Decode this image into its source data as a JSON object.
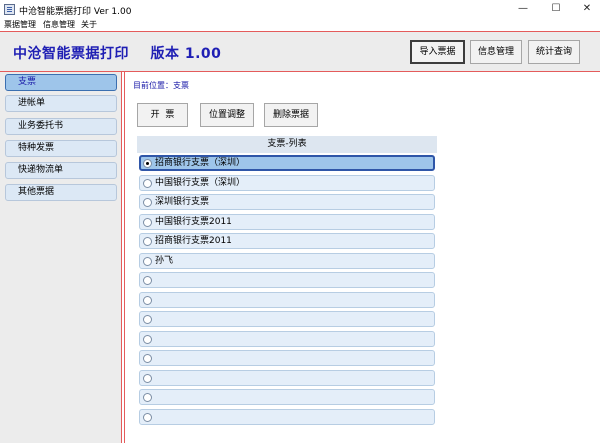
{
  "window": {
    "title": "中沧智能票据打印 Ver 1.00",
    "controls": {
      "minimize": "—",
      "maximize": "☐",
      "close": "✕"
    }
  },
  "menu": [
    "票据管理",
    "信息管理",
    "关于"
  ],
  "header": {
    "app_name": "中沧智能票据打印    版本 1.00",
    "buttons": [
      "导入票据",
      "信息管理",
      "统计查询"
    ],
    "active_button": "导入票据"
  },
  "sidebar": {
    "items": [
      {
        "label": "支票",
        "selected": true
      },
      {
        "label": "进帐单",
        "selected": false
      },
      {
        "label": "业务委托书",
        "selected": false
      },
      {
        "label": "特种发票",
        "selected": false
      },
      {
        "label": "快递物流单",
        "selected": false
      },
      {
        "label": "其他票据",
        "selected": false
      }
    ]
  },
  "main": {
    "breadcrumb": "目前位置：支票",
    "actions": [
      "开  票",
      "位置调整",
      "删除票据"
    ],
    "list": {
      "title": "支票-列表",
      "rows": [
        {
          "label": "招商银行支票（深圳）",
          "selected": true
        },
        {
          "label": "中国银行支票（深圳）",
          "selected": false
        },
        {
          "label": "深圳银行支票",
          "selected": false
        },
        {
          "label": "中国银行支票2011",
          "selected": false
        },
        {
          "label": "招商银行支票2011",
          "selected": false
        },
        {
          "label": "孙飞",
          "selected": false
        },
        {
          "label": "",
          "selected": false
        },
        {
          "label": "",
          "selected": false
        },
        {
          "label": "",
          "selected": false
        },
        {
          "label": "",
          "selected": false
        },
        {
          "label": "",
          "selected": false
        },
        {
          "label": "",
          "selected": false
        },
        {
          "label": "",
          "selected": false
        },
        {
          "label": "",
          "selected": false
        }
      ]
    }
  },
  "colors": {
    "accent_red": "#e45b5b",
    "title_blue": "#1f1fb4",
    "selected_fill": "#9ec5ea",
    "row_fill": "#e4eef9"
  }
}
